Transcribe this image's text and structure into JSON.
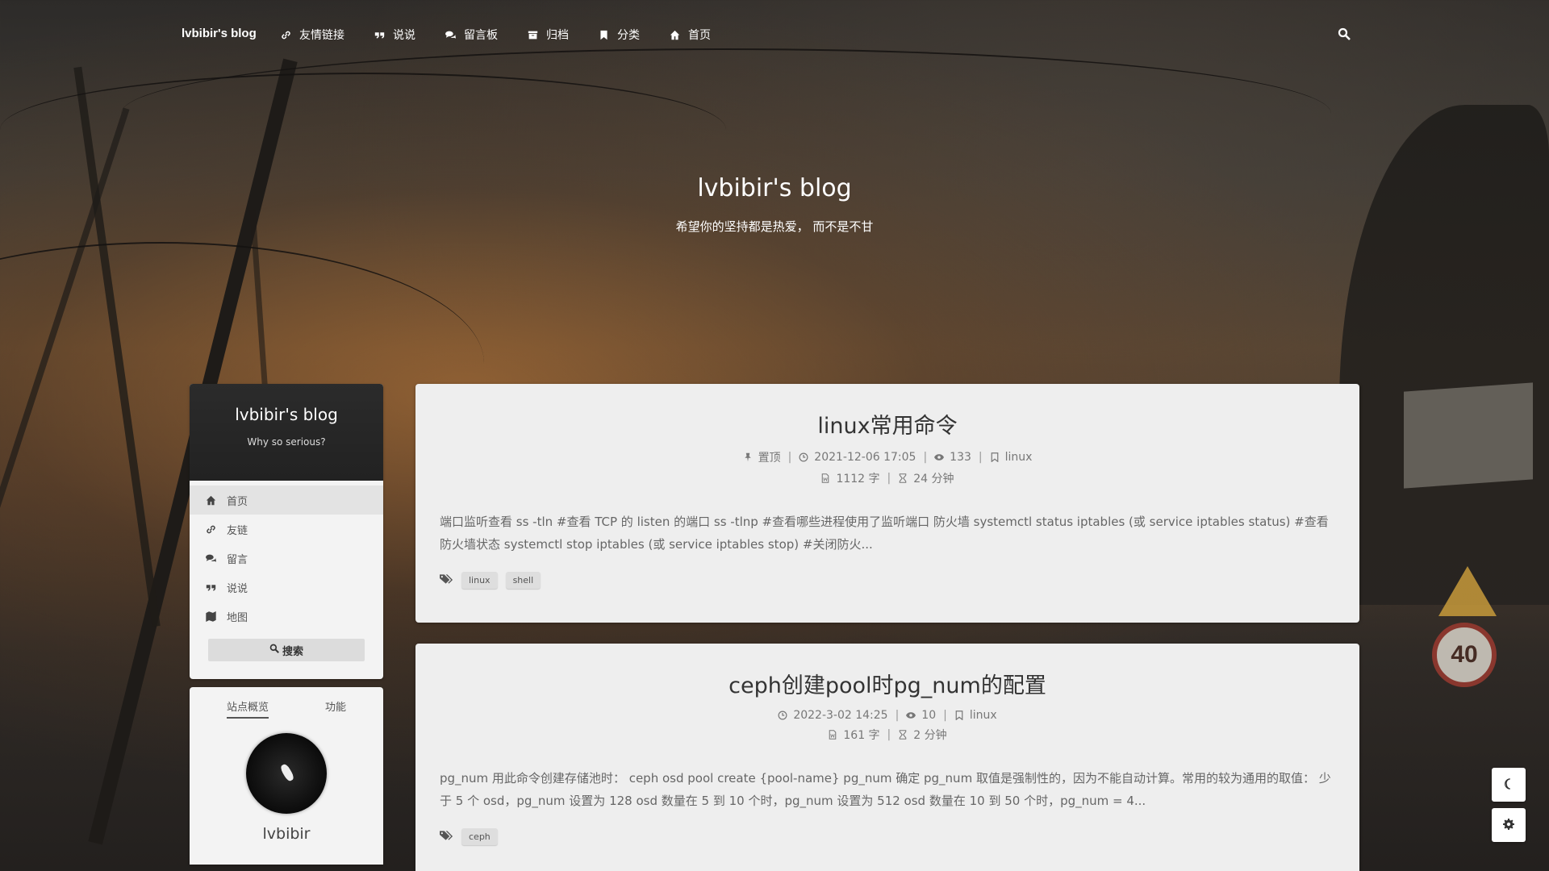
{
  "nav": {
    "brand": "lvbibir's blog",
    "links": [
      {
        "label": "友情链接",
        "icon": "link-icon"
      },
      {
        "label": "说说",
        "icon": "quote-icon"
      },
      {
        "label": "留言板",
        "icon": "comments-icon"
      },
      {
        "label": "归档",
        "icon": "archive-icon"
      },
      {
        "label": "分类",
        "icon": "bookmark-icon"
      },
      {
        "label": "首页",
        "icon": "home-icon"
      }
    ],
    "search_icon": "search-icon"
  },
  "header": {
    "title": "lvbibir's blog",
    "subtitle": "希望你的坚持都是热爱， 而不是不甘"
  },
  "sidebar": {
    "brand_title": "lvbibir's blog",
    "brand_subtitle": "Why so serious?",
    "menu": [
      {
        "label": "首页",
        "icon": "home-icon"
      },
      {
        "label": "友链",
        "icon": "link-icon"
      },
      {
        "label": "留言",
        "icon": "comments-icon"
      },
      {
        "label": "说说",
        "icon": "quote-icon"
      },
      {
        "label": "地图",
        "icon": "map-icon"
      }
    ],
    "search_label": "搜索",
    "overview_tabs": [
      "站点概览",
      "功能"
    ],
    "author": "lvbibir"
  },
  "posts": [
    {
      "title": "linux常用命令",
      "pinned": "置顶",
      "date": "2021-12-06 17:05",
      "views": "133",
      "category": "linux",
      "words": "1112 字",
      "read_time": "24 分钟",
      "excerpt": "端口监听查看 ss -tln #查看 TCP 的 listen 的端口 ss -tlnp #查看哪些进程使用了监听端口 防火墙 systemctl status iptables (或 service iptables status) #查看防火墙状态 systemctl stop iptables (或 service iptables stop) #关闭防火...",
      "tags": [
        "linux",
        "shell"
      ]
    },
    {
      "title": "ceph创建pool时pg_num的配置",
      "date": "2022-3-02 14:25",
      "views": "10",
      "category": "linux",
      "words": "161 字",
      "read_time": "2 分钟",
      "excerpt": "pg_num 用此命令创建存储池时： ceph osd pool create {pool-name} pg_num 确定 pg_num 取值是强制性的，因为不能自动计算。常用的较为通用的取值： 少于 5 个 osd，pg_num 设置为 128 osd 数量在 5 到 10 个时，pg_num 设置为 512 osd 数量在 10 到 50 个时，pg_num = 4...",
      "tags": [
        "ceph"
      ]
    }
  ],
  "floating": {
    "theme_icon": "moon-icon",
    "settings_icon": "gear-icon"
  }
}
